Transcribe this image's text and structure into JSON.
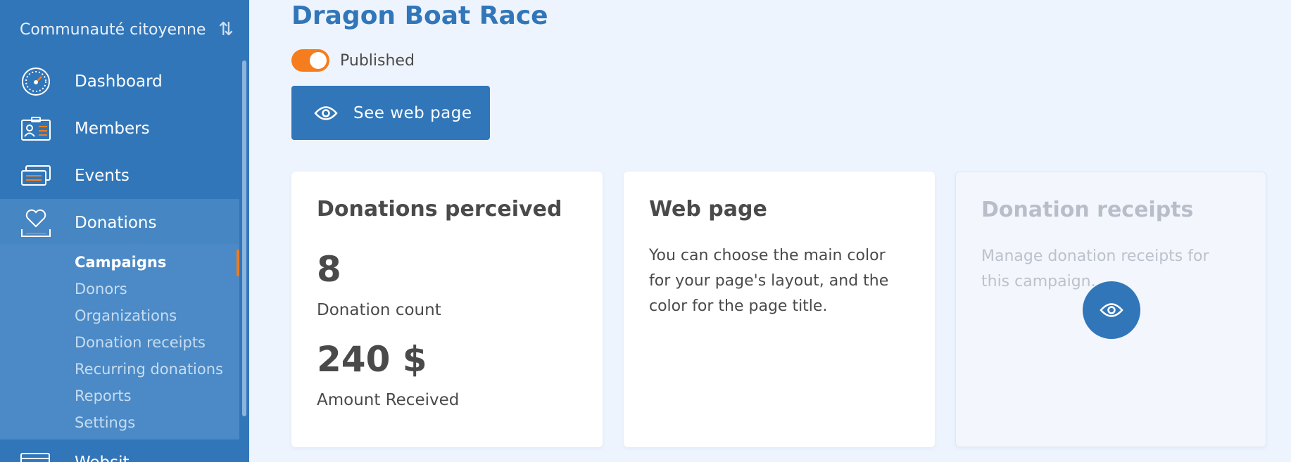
{
  "sidebar": {
    "org_name": "Communauté citoyenne",
    "items": [
      {
        "label": "Dashboard",
        "icon": "speedometer-icon"
      },
      {
        "label": "Members",
        "icon": "member-card-icon"
      },
      {
        "label": "Events",
        "icon": "tickets-icon"
      },
      {
        "label": "Donations",
        "icon": "heart-hand-icon"
      },
      {
        "label": "Websit",
        "icon": "browser-window-icon"
      }
    ],
    "submenu": [
      {
        "label": "Campaigns"
      },
      {
        "label": "Donors"
      },
      {
        "label": "Organizations"
      },
      {
        "label": "Donation receipts"
      },
      {
        "label": "Recurring donations"
      },
      {
        "label": "Reports"
      },
      {
        "label": "Settings"
      }
    ]
  },
  "page": {
    "title": "Dragon Boat Race",
    "published_label": "Published",
    "published": true,
    "see_web_page_label": "See web page"
  },
  "cards": {
    "donations": {
      "title": "Donations perceived",
      "count": "8",
      "count_label": "Donation count",
      "amount": "240 $",
      "amount_label": "Amount Received"
    },
    "web_page": {
      "title": "Web page",
      "description": "You can choose the main color for your page's layout, and the color for the page title."
    },
    "receipts": {
      "title": "Donation receipts",
      "description": "Manage donation receipts for this campaign."
    }
  },
  "colors": {
    "primary": "#3176b9",
    "accent": "#f57d1d",
    "background": "#eef4fd"
  }
}
